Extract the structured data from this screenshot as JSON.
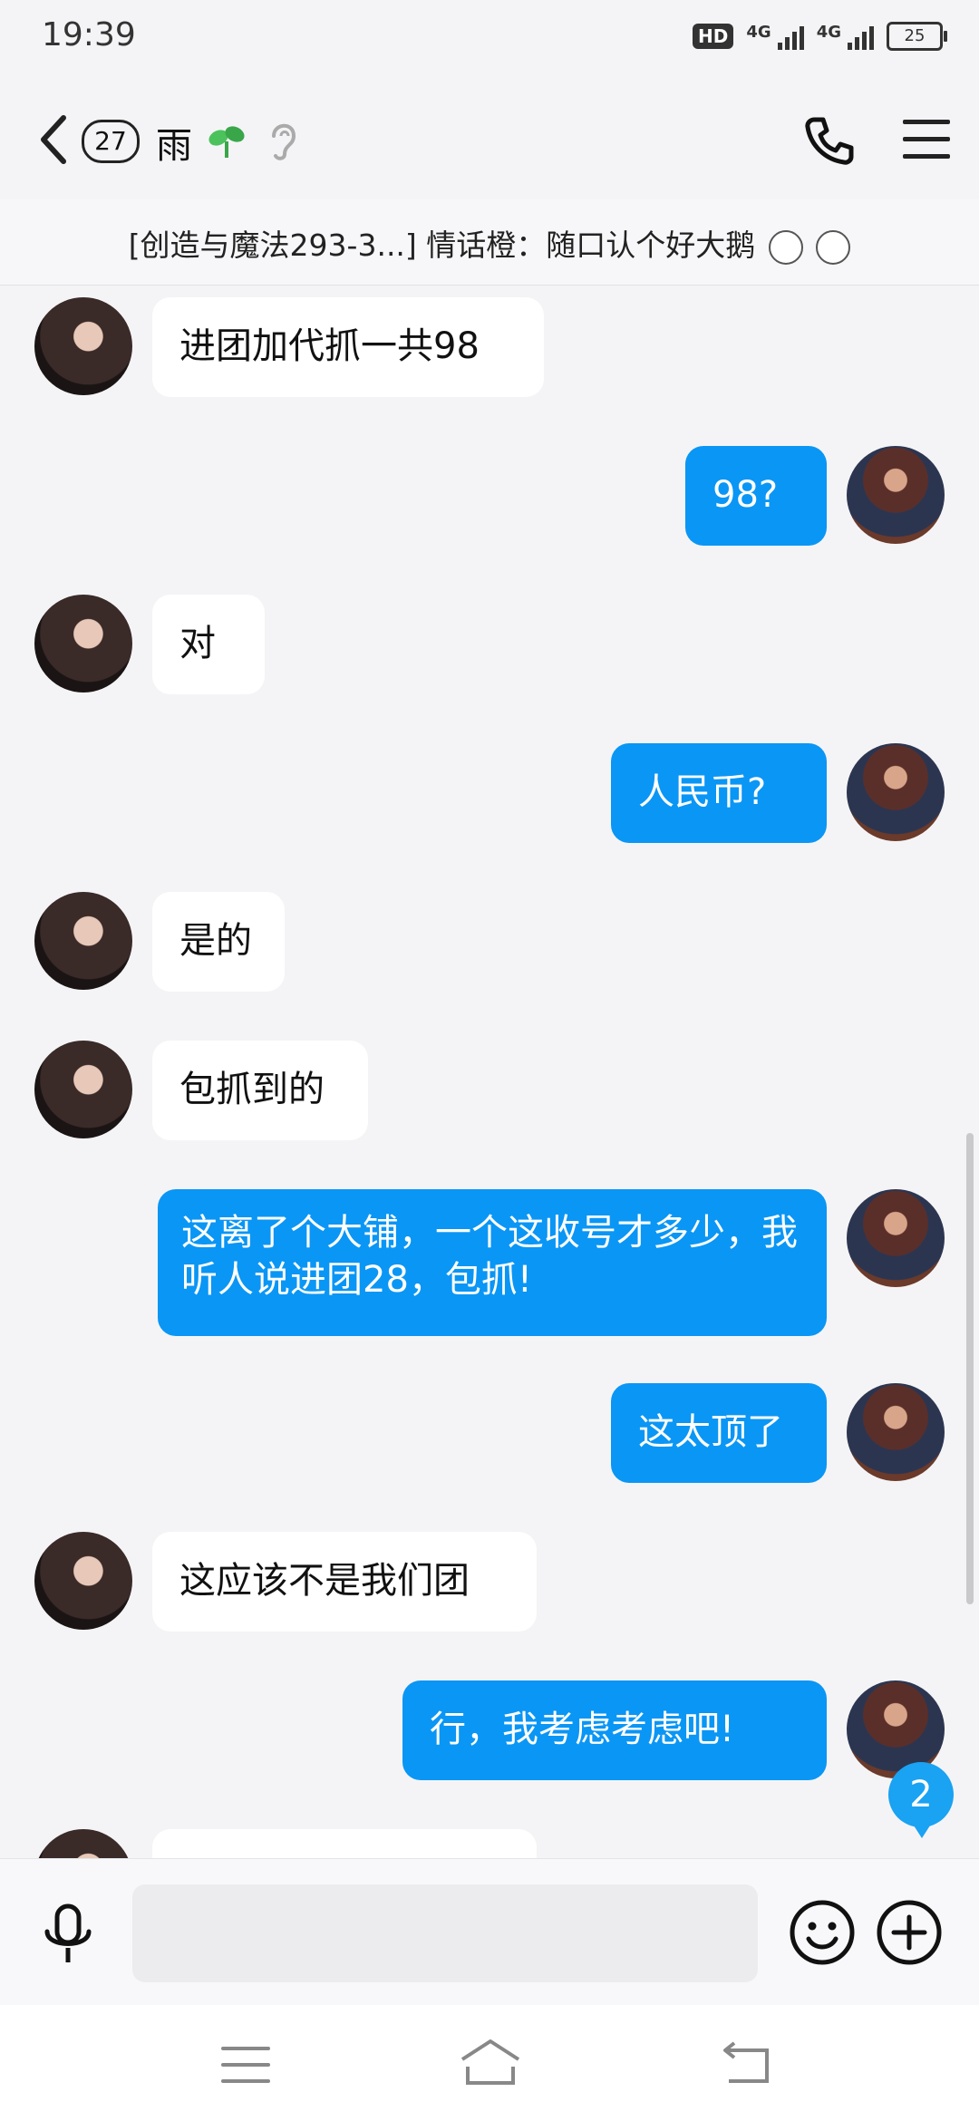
{
  "status_bar": {
    "time": "19:39",
    "hd": "HD",
    "network1": "4G",
    "network2": "4G",
    "battery": "25"
  },
  "header": {
    "unread_count": "27",
    "title": "雨",
    "icons": [
      "back-icon",
      "sprout-icon",
      "ear-icon",
      "phone-icon",
      "menu-icon"
    ]
  },
  "notice": {
    "text": "[创造与魔法293-3...] 情话橙：随口认个好大鹅"
  },
  "messages": [
    {
      "side": "left",
      "text": "进团加代抓一共98"
    },
    {
      "side": "right",
      "text": "98?"
    },
    {
      "side": "left",
      "text": "对"
    },
    {
      "side": "right",
      "text": "人民币?"
    },
    {
      "side": "left",
      "text": "是的"
    },
    {
      "side": "left",
      "text": "包抓到的"
    },
    {
      "side": "right",
      "text": "这离了个大铺，一个这收号才多少，我听人说进团28，包抓!"
    },
    {
      "side": "right",
      "text": "这太顶了"
    },
    {
      "side": "left",
      "text": "这应该不是我们团"
    },
    {
      "side": "right",
      "text": "行，我考虑考虑吧!"
    }
  ],
  "new_message_badge": "2",
  "colors": {
    "accent": "#0a96f5",
    "background": "#f4f4f6",
    "bubble_left": "#ffffff"
  }
}
